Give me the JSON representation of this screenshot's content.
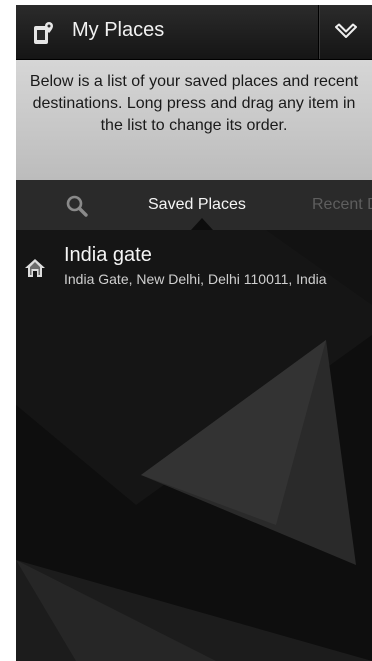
{
  "header": {
    "title": "My Places",
    "app_icon": "phone-pin-icon",
    "menu_icon": "chevron-down-icon"
  },
  "banner": {
    "text": "Below is a list of your saved places and recent destinations. Long press and drag any item in the list to change its order."
  },
  "tabs": {
    "search_icon": "search-icon",
    "items": [
      {
        "label": "Saved Places",
        "active": true
      },
      {
        "label": "Recent Destinations",
        "active": false
      }
    ]
  },
  "saved_places": [
    {
      "name": "India gate",
      "address": "India Gate, New Delhi, Delhi 110011, India",
      "icon": "home-icon"
    }
  ],
  "colors": {
    "background": "#0d0d0d",
    "banner": "#c9c9c9",
    "tab_bar": "#2a2a2a",
    "active_tab_text": "#f5f5f5",
    "inactive_tab_text": "#5e5e5e"
  }
}
